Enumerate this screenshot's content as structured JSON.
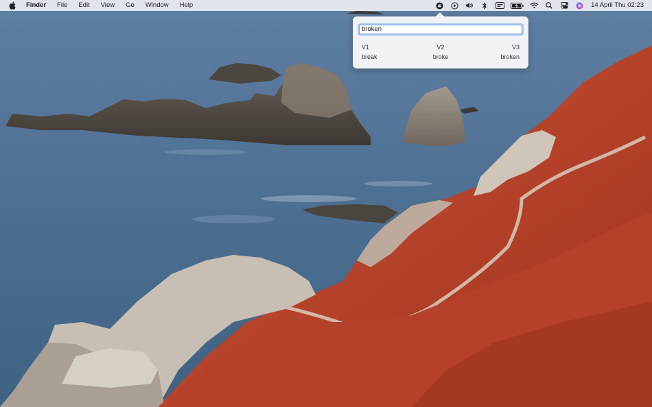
{
  "menubar": {
    "apple_icon": "apple-logo-icon",
    "items": [
      "Finder",
      "File",
      "Edit",
      "View",
      "Go",
      "Window",
      "Help"
    ],
    "status_icons": [
      "app-indicator-icon",
      "play-circle-icon",
      "volume-icon",
      "bluetooth-icon",
      "keyboard-input-icon",
      "battery-charging-icon",
      "wifi-icon",
      "search-icon",
      "control-center-icon",
      "siri-icon"
    ],
    "clock": "14 April Thu  02:23"
  },
  "popover": {
    "search_value": "broken",
    "headers": [
      "V1",
      "V2",
      "V3"
    ],
    "forms": [
      "break",
      "broke",
      "broken"
    ]
  },
  "colors": {
    "sea": "#4d6f92",
    "ice_plant": "#b8442a",
    "rock": "#8d8478",
    "focus_ring": "#5896e6"
  }
}
